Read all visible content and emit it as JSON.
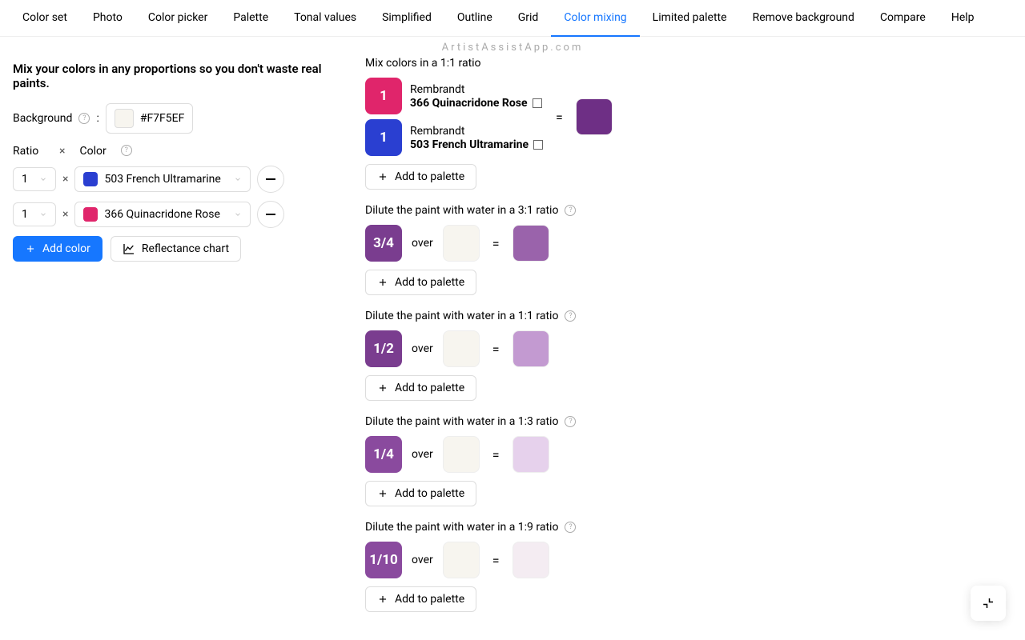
{
  "tabs": [
    "Color set",
    "Photo",
    "Color picker",
    "Palette",
    "Tonal values",
    "Simplified",
    "Outline",
    "Grid",
    "Color mixing",
    "Limited palette",
    "Remove background",
    "Compare",
    "Help"
  ],
  "activeTab": "Color mixing",
  "watermark": "ArtistAssistApp.com",
  "heading": "Mix your colors in any proportions so you don't waste real paints.",
  "left": {
    "backgroundLabel": "Background",
    "backgroundHex": "#F7F5EF",
    "ratioLabel": "Ratio",
    "colorLabel": "Color",
    "rows": [
      {
        "ratio": "1",
        "color": "#2a3fd1",
        "name": "503 French Ultramarine"
      },
      {
        "ratio": "1",
        "color": "#e0256b",
        "name": "366 Quinacridone Rose"
      }
    ],
    "addColor": "Add color",
    "reflectance": "Reflectance chart"
  },
  "mixTitle": "Mix colors in a 1:1 ratio",
  "mixPaints": [
    {
      "ratio": "1",
      "swatch": "#e0256b",
      "brand": "Rembrandt",
      "name": "366 Quinacridone Rose"
    },
    {
      "ratio": "1",
      "swatch": "#2a3fd1",
      "brand": "Rembrandt",
      "name": "503 French Ultramarine"
    }
  ],
  "mixResult": "#6e2f85",
  "addPalette": "Add to palette",
  "overText": "over",
  "dilutions": [
    {
      "title": "Dilute the paint with water in a 3:1 ratio",
      "frac": "3/4",
      "swatch": "#7a3d8f",
      "result": "#9a63ab"
    },
    {
      "title": "Dilute the paint with water in a 1:1 ratio",
      "frac": "1/2",
      "swatch": "#7a3d8f",
      "result": "#c39ad1"
    },
    {
      "title": "Dilute the paint with water in a 1:3 ratio",
      "frac": "1/4",
      "swatch": "#8a4a9e",
      "result": "#e6d1ec"
    },
    {
      "title": "Dilute the paint with water in a 1:9 ratio",
      "frac": "1/10",
      "swatch": "#8a4a9e",
      "result": "#f4ecf2"
    }
  ]
}
